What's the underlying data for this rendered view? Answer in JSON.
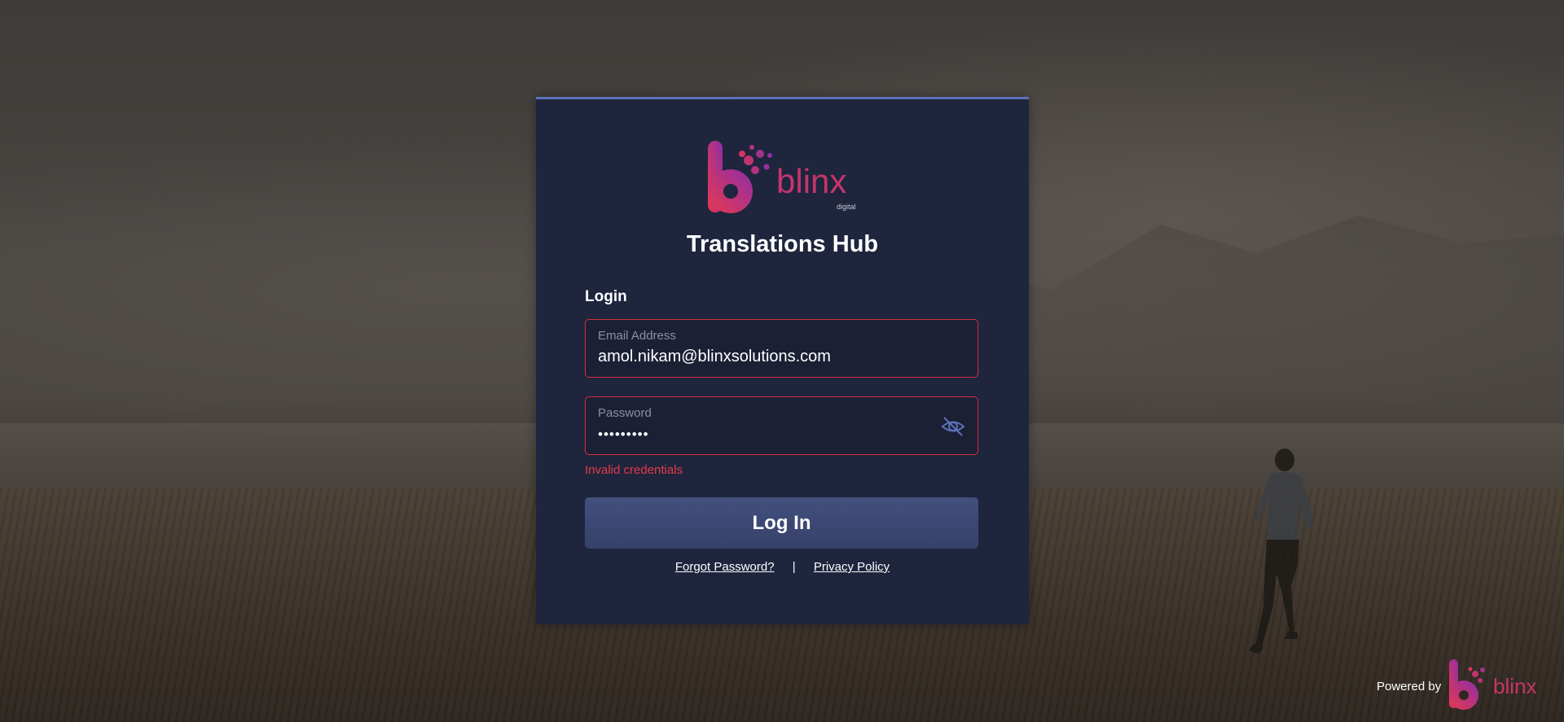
{
  "brand": {
    "logo_word": "blinx",
    "logo_sub": "digital",
    "gradient_start": "#e8384f",
    "gradient_end": "#8e2fa6"
  },
  "card": {
    "app_title": "Translations Hub",
    "form_heading": "Login"
  },
  "email": {
    "label": "Email Address",
    "value": "amol.nikam@blinxsolutions.com"
  },
  "password": {
    "label": "Password",
    "masked_value": "•••••••••",
    "toggle_icon": "eye-off-icon"
  },
  "error": {
    "message": "Invalid credentials",
    "color": "#e83a47"
  },
  "actions": {
    "login_label": "Log In",
    "forgot_label": "Forgot Password?",
    "separator": "|",
    "privacy_label": "Privacy Policy"
  },
  "footer": {
    "powered_text": "Powered by",
    "logo_word": "blinx"
  },
  "colors": {
    "card_bg": "#1e253d",
    "card_top_border": "#5b73b8",
    "field_border_error": "#d32f3f",
    "button_bg": "#3d4874"
  }
}
